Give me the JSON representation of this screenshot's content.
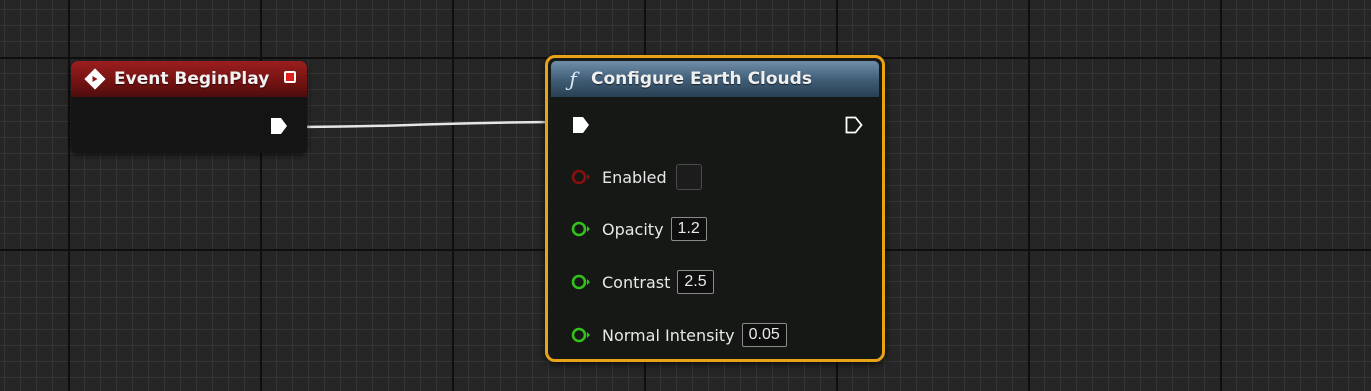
{
  "graph": {
    "grid_color": "#262626",
    "wire_color": "#e6e6e6"
  },
  "event_node": {
    "title": "Event BeginPlay",
    "icon": "event-diamond-icon",
    "header_color": "#8a1717",
    "delegate_pin_color": "#e01e1e"
  },
  "function_node": {
    "icon": "function-icon",
    "icon_glyph": "ƒ",
    "title": "Configure Earth Clouds",
    "selection_color": "#e8a317",
    "header_color": "#4a6a86",
    "params": [
      {
        "label": "Enabled",
        "pin_type": "boolean",
        "pin_color": "#8a0f0f",
        "value": ""
      },
      {
        "label": "Opacity",
        "pin_type": "float",
        "pin_color": "#33c21a",
        "value": "1.2"
      },
      {
        "label": "Contrast",
        "pin_type": "float",
        "pin_color": "#33c21a",
        "value": "2.5"
      },
      {
        "label": "Normal Intensity",
        "pin_type": "float",
        "pin_color": "#33c21a",
        "value": "0.05"
      }
    ]
  }
}
